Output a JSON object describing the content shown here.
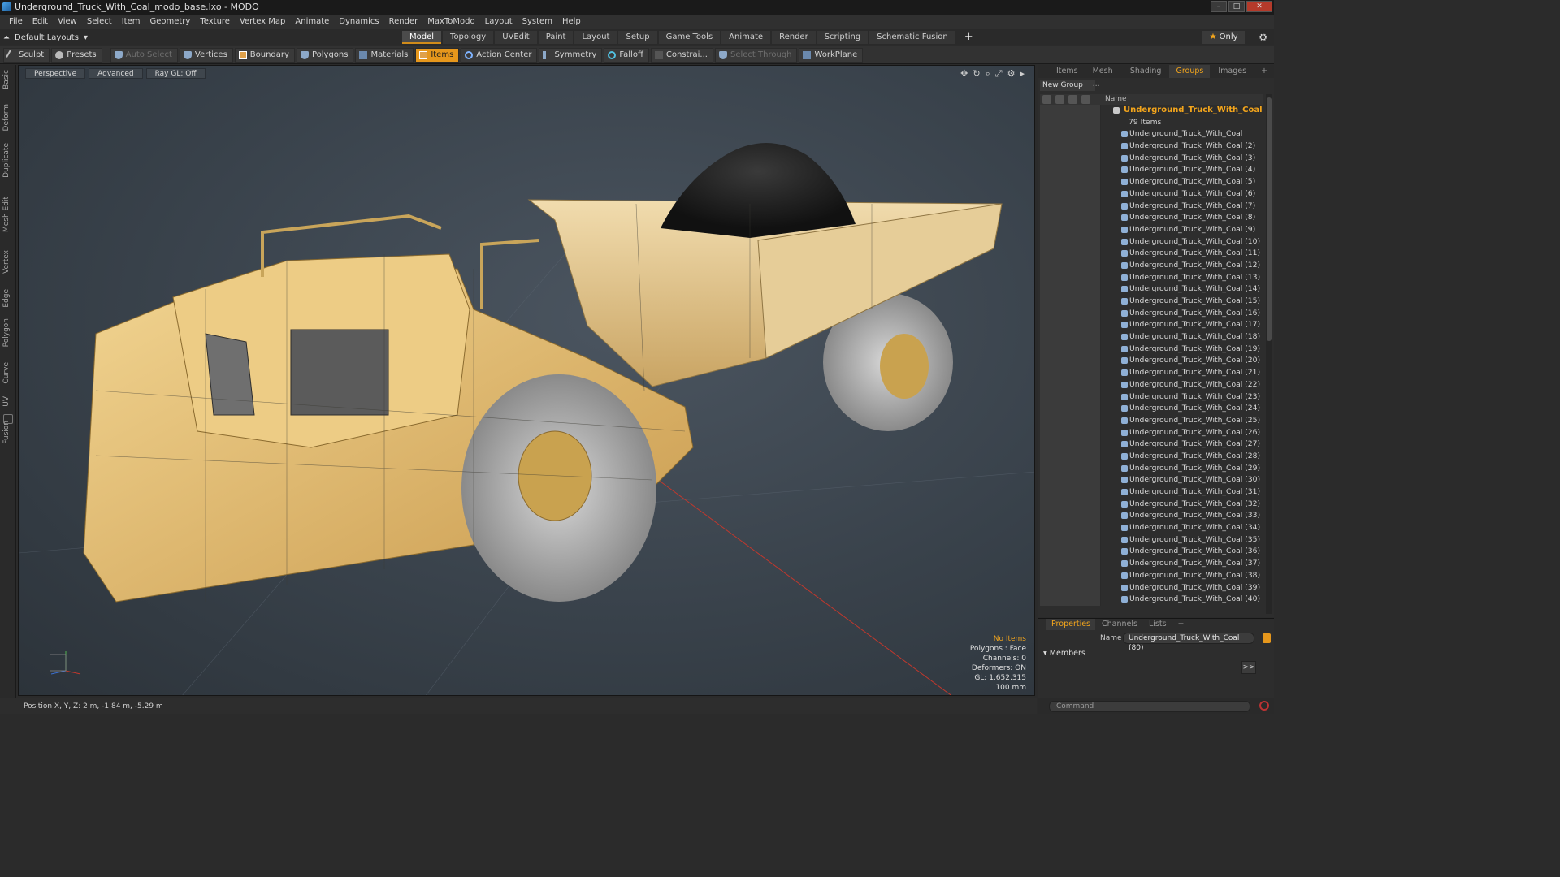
{
  "window": {
    "title": "Underground_Truck_With_Coal_modo_base.lxo - MODO"
  },
  "menu": [
    "File",
    "Edit",
    "View",
    "Select",
    "Item",
    "Geometry",
    "Texture",
    "Vertex Map",
    "Animate",
    "Dynamics",
    "Render",
    "MaxToModo",
    "Layout",
    "System",
    "Help"
  ],
  "layoutbar": {
    "layouts_label": "Default Layouts",
    "tabs": [
      "Model",
      "Topology",
      "UVEdit",
      "Paint",
      "Layout",
      "Setup",
      "Game Tools",
      "Animate",
      "Render",
      "Scripting",
      "Schematic Fusion"
    ],
    "active_tab": "Model",
    "only_label": "Only"
  },
  "toolbar": {
    "sculpt": "Sculpt",
    "presets": "Presets",
    "auto_select": "Auto Select",
    "vertices": "Vertices",
    "boundary": "Boundary",
    "polygons": "Polygons",
    "materials": "Materials",
    "items": "Items",
    "action_center": "Action Center",
    "symmetry": "Symmetry",
    "falloff": "Falloff",
    "constraints": "Constrai...",
    "select_through": "Select Through",
    "workplane": "WorkPlane"
  },
  "left_tabs": [
    "Basic",
    "Deform",
    "Duplicate",
    "Mesh Edit",
    "Vertex",
    "Edge",
    "Polygon",
    "Curve",
    "UV",
    "Fusion"
  ],
  "viewport": {
    "buttons": [
      "Perspective",
      "Advanced",
      "Ray GL: Off"
    ],
    "info": {
      "selection": "No Items",
      "polygons": "Polygons : Face",
      "channels": "Channels: 0",
      "deformers": "Deformers: ON",
      "gl": "GL: 1,652,315",
      "scale": "100 mm"
    }
  },
  "status": {
    "position": "Position X, Y, Z:  2 m, -1.84 m, -5.29 m"
  },
  "groups_panel": {
    "tabs": [
      "Items",
      "Mesh ...",
      "Shading",
      "Groups",
      "Images"
    ],
    "active_tab": "Groups",
    "new_group": "New Group",
    "column_name": "Name",
    "group_name": "Underground_Truck_With_Coal",
    "group_count": "79 Items",
    "items": [
      "Underground_Truck_With_Coal",
      "Underground_Truck_With_Coal (2)",
      "Underground_Truck_With_Coal (3)",
      "Underground_Truck_With_Coal (4)",
      "Underground_Truck_With_Coal (5)",
      "Underground_Truck_With_Coal (6)",
      "Underground_Truck_With_Coal (7)",
      "Underground_Truck_With_Coal (8)",
      "Underground_Truck_With_Coal (9)",
      "Underground_Truck_With_Coal (10)",
      "Underground_Truck_With_Coal (11)",
      "Underground_Truck_With_Coal (12)",
      "Underground_Truck_With_Coal (13)",
      "Underground_Truck_With_Coal (14)",
      "Underground_Truck_With_Coal (15)",
      "Underground_Truck_With_Coal (16)",
      "Underground_Truck_With_Coal (17)",
      "Underground_Truck_With_Coal (18)",
      "Underground_Truck_With_Coal (19)",
      "Underground_Truck_With_Coal (20)",
      "Underground_Truck_With_Coal (21)",
      "Underground_Truck_With_Coal (22)",
      "Underground_Truck_With_Coal (23)",
      "Underground_Truck_With_Coal (24)",
      "Underground_Truck_With_Coal (25)",
      "Underground_Truck_With_Coal (26)",
      "Underground_Truck_With_Coal (27)",
      "Underground_Truck_With_Coal (28)",
      "Underground_Truck_With_Coal (29)",
      "Underground_Truck_With_Coal (30)",
      "Underground_Truck_With_Coal (31)",
      "Underground_Truck_With_Coal (32)",
      "Underground_Truck_With_Coal (33)",
      "Underground_Truck_With_Coal (34)",
      "Underground_Truck_With_Coal (35)",
      "Underground_Truck_With_Coal (36)",
      "Underground_Truck_With_Coal (37)",
      "Underground_Truck_With_Coal (38)",
      "Underground_Truck_With_Coal (39)",
      "Underground_Truck_With_Coal (40)"
    ]
  },
  "properties_panel": {
    "tabs": [
      "Properties",
      "Channels",
      "Lists"
    ],
    "active_tab": "Properties",
    "name_label": "Name",
    "name_value": "Underground_Truck_With_Coal (80)",
    "members_label": "Members",
    "arrow_button": ">>"
  },
  "command": {
    "placeholder": "Command"
  },
  "colors": {
    "accent": "#e6971c",
    "truck_body": "#e8c57a",
    "viewport_bg": "#3c454e"
  }
}
